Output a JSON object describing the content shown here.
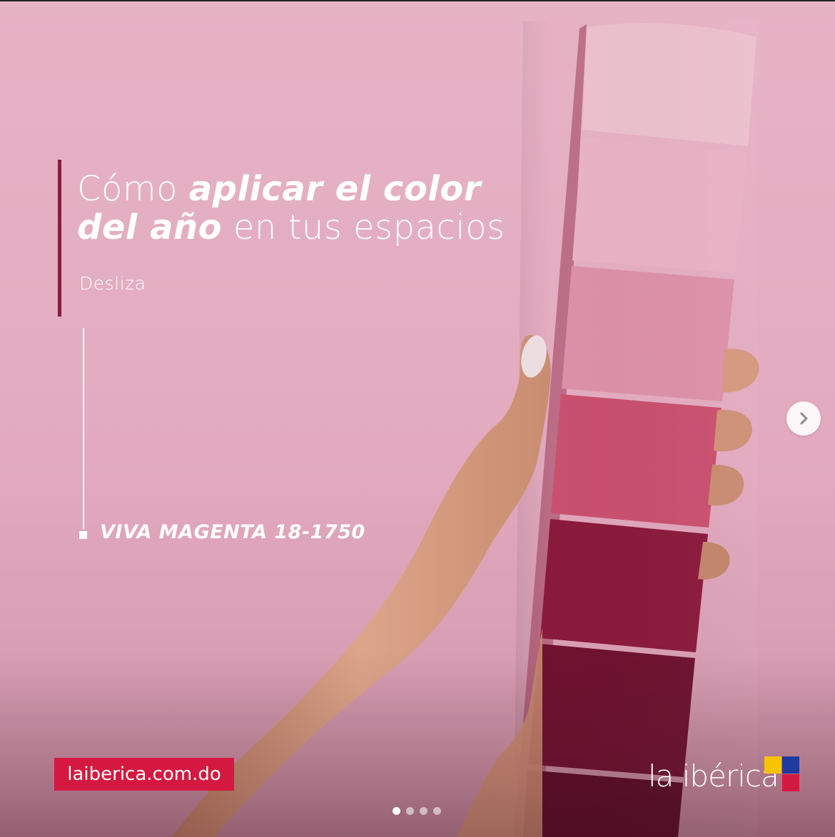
{
  "slide": {
    "headline_part1": "Cómo ",
    "headline_bold1": "aplicar el color",
    "headline_bold2": "del año",
    "headline_part2": " en tus espacios",
    "swipe_label": "Desliza",
    "color_code": "VIVA MAGENTA 18-1750"
  },
  "footer": {
    "website": "laiberica.com.do",
    "brand": "la ibérica"
  },
  "brand_colors": {
    "accent": "#8b1a3f",
    "badge": "#d4183f",
    "flag_yellow": "#f6c400",
    "flag_blue": "#1f3aa0",
    "flag_red": "#d4183f"
  },
  "swatches": [
    "#ecc0cd",
    "#e8b3c4",
    "#dc90a8",
    "#c9506f",
    "#8a1a3c",
    "#6e1230",
    "#5c0d27"
  ],
  "carousel": {
    "total": 4,
    "active_index": 0,
    "next_icon": "chevron-right-icon"
  }
}
